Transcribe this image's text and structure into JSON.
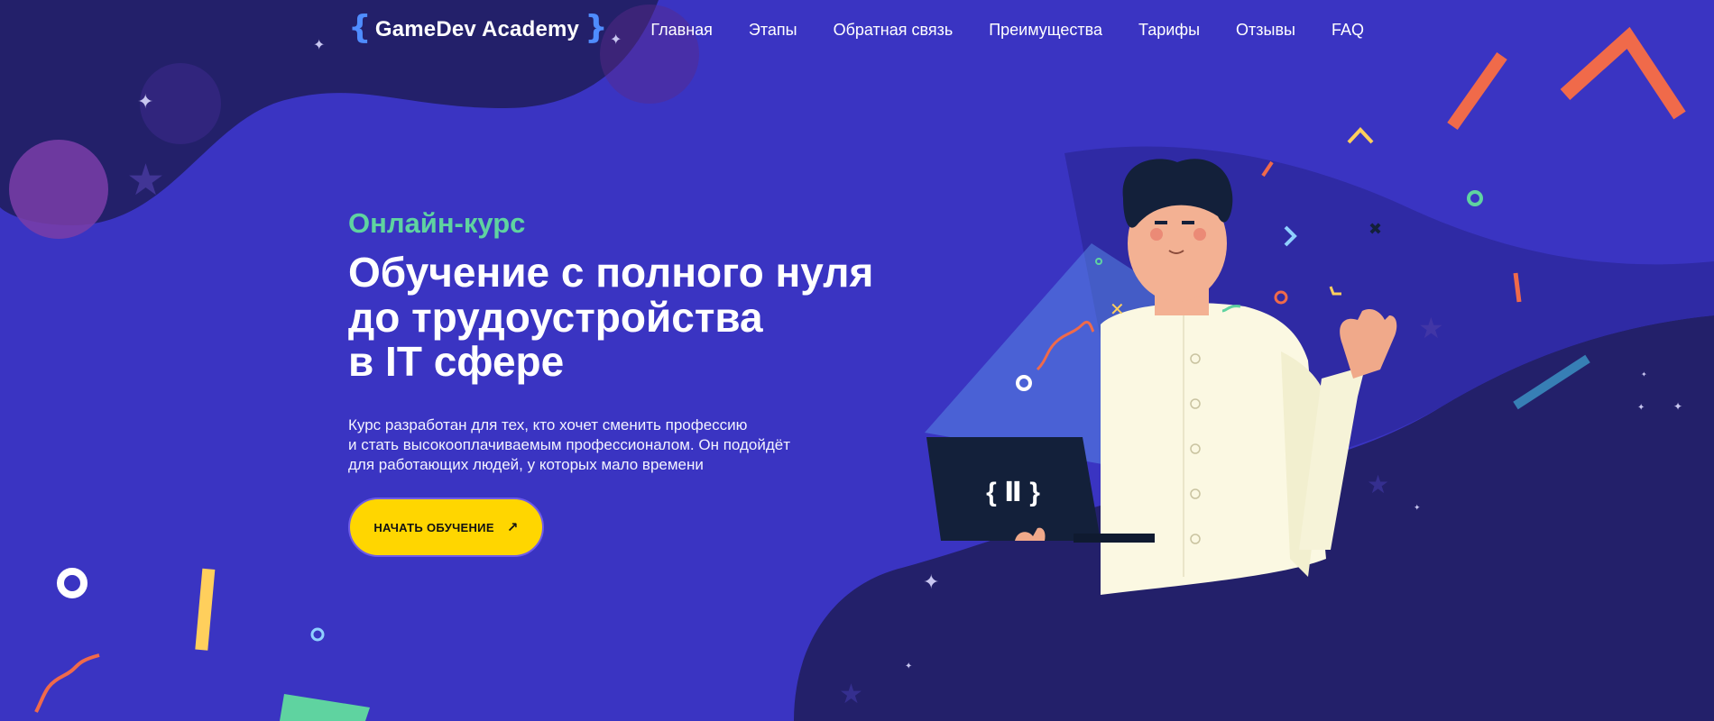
{
  "header": {
    "logo_brace_left": "{",
    "logo_text": "GameDev Academy",
    "logo_brace_right": "}",
    "nav": [
      {
        "label": "Главная"
      },
      {
        "label": "Этапы"
      },
      {
        "label": "Обратная связь"
      },
      {
        "label": "Преимущества"
      },
      {
        "label": "Тарифы"
      },
      {
        "label": "Отзывы"
      },
      {
        "label": "FAQ"
      }
    ]
  },
  "hero": {
    "eyebrow": "Онлайн-курс",
    "title_lines": [
      "Обучение с полного нуля",
      "до трудоустройства",
      "в IT сфере"
    ],
    "description_lines": [
      "Курс разработан для тех, кто хочет сменить профессию",
      "и стать высокооплачиваемым профессионалом. Он подойдёт",
      "для работающих людей, у которых мало времени"
    ],
    "cta_label": "НАЧАТЬ ОБУЧЕНИЕ",
    "cta_icon": "arrow-up-right-icon"
  },
  "illustration": {
    "subject": "man-with-laptop-waving",
    "laptop_logo": "{ Ⅱ }"
  },
  "colors": {
    "background": "#3a34c2",
    "dark_wave": "#24216a",
    "accent_green": "#5fd3a0",
    "cta_yellow": "#ffd600",
    "logo_blue": "#4f8cff",
    "confetti_orange": "#f06a4a"
  }
}
